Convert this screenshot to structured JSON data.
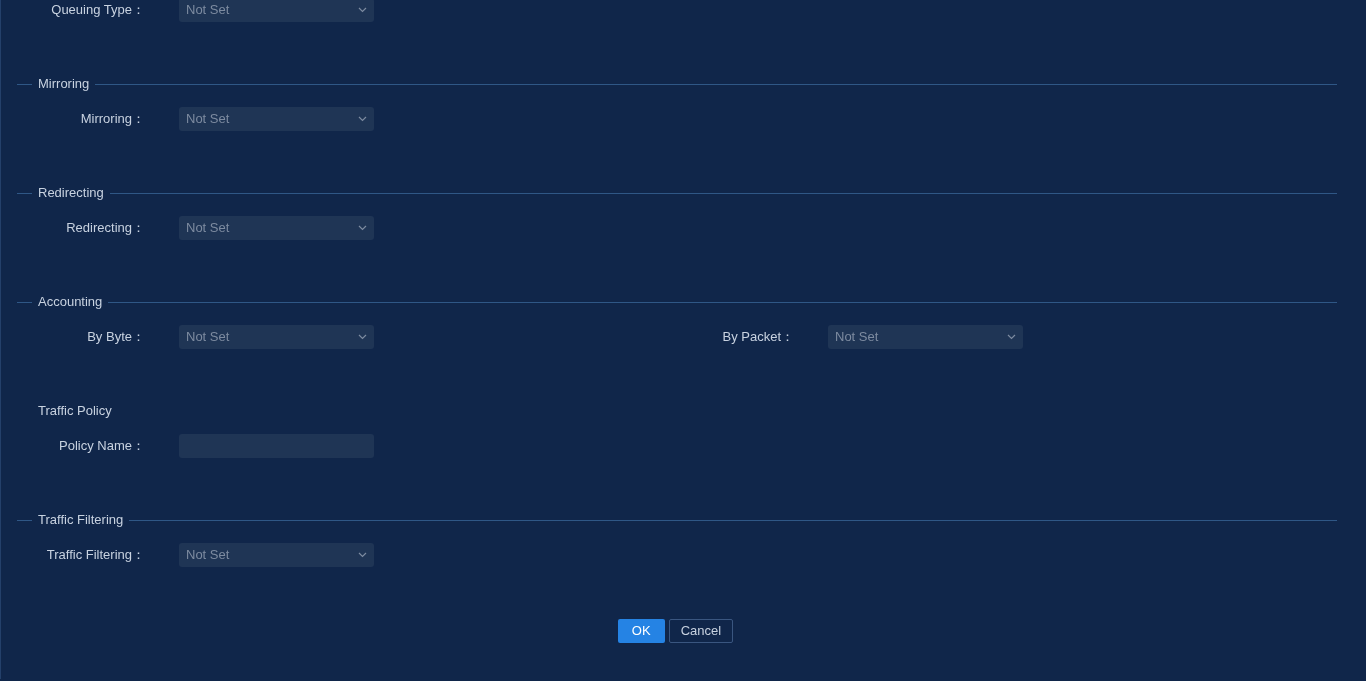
{
  "top_fields": [
    {
      "label": "Queuing Type：",
      "kind": "select",
      "value": "Not Set"
    }
  ],
  "sections": [
    {
      "title": "Mirroring",
      "divider": true,
      "fields": [
        {
          "label": "Mirroring：",
          "kind": "select",
          "value": "Not Set"
        }
      ]
    },
    {
      "title": "Redirecting",
      "divider": true,
      "fields": [
        {
          "label": "Redirecting：",
          "kind": "select",
          "value": "Not Set"
        }
      ]
    },
    {
      "title": "Accounting",
      "divider": true,
      "fields": [
        {
          "label": "By Byte：",
          "kind": "select",
          "value": "Not Set"
        },
        {
          "label": "By Packet：",
          "kind": "select",
          "value": "Not Set"
        }
      ]
    },
    {
      "title": "Traffic Policy",
      "divider": false,
      "fields": [
        {
          "label": "Policy Name：",
          "kind": "text"
        }
      ]
    },
    {
      "title": "Traffic Filtering",
      "divider": true,
      "fields": [
        {
          "label": "Traffic Filtering：",
          "kind": "select",
          "value": "Not Set"
        }
      ]
    }
  ],
  "buttons": [
    {
      "label": "OK",
      "primary": true
    },
    {
      "label": "Cancel",
      "primary": false
    }
  ]
}
